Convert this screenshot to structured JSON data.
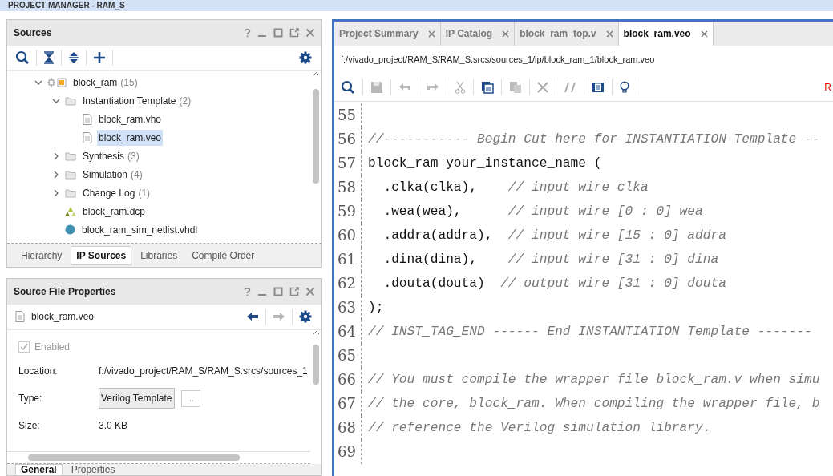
{
  "header": {
    "title": "PROJECT MANAGER - RAM_S"
  },
  "sources": {
    "title": "Sources",
    "tree": [
      {
        "label": "block_ram",
        "count": "(15)",
        "kind": "ip",
        "expanded": true,
        "selected": false,
        "children": [
          {
            "label": "Instantiation Template",
            "count": "(2)",
            "kind": "folder",
            "expanded": true,
            "selected": false,
            "children": [
              {
                "label": "block_ram.vho",
                "kind": "file",
                "selected": false
              },
              {
                "label": "block_ram.veo",
                "kind": "file",
                "selected": true
              }
            ]
          },
          {
            "label": "Synthesis",
            "count": "(3)",
            "kind": "folder",
            "expanded": false,
            "selected": false
          },
          {
            "label": "Simulation",
            "count": "(4)",
            "kind": "folder",
            "expanded": false,
            "selected": false
          },
          {
            "label": "Change Log",
            "count": "(1)",
            "kind": "folder",
            "expanded": false,
            "selected": false
          },
          {
            "label": "block_ram.dcp",
            "kind": "dcp",
            "selected": false
          },
          {
            "label": "block_ram_sim_netlist.vhdl",
            "kind": "netlist",
            "selected": false
          }
        ]
      }
    ],
    "tabs": [
      {
        "label": "Hierarchy",
        "selected": false
      },
      {
        "label": "IP Sources",
        "selected": true
      },
      {
        "label": "Libraries",
        "selected": false
      },
      {
        "label": "Compile Order",
        "selected": false
      }
    ]
  },
  "properties": {
    "title": "Source File Properties",
    "file": "block_ram.veo",
    "enabled": {
      "label": "Enabled",
      "checked": true,
      "disabled": true
    },
    "fields": [
      {
        "label": "Location:",
        "value": "f:/vivado_project/RAM_S/RAM_S.srcs/sources_1",
        "kind": "text"
      },
      {
        "label": "Type:",
        "value": "Verilog Template",
        "kind": "button",
        "more": "..."
      },
      {
        "label": "Size:",
        "value": "3.0 KB",
        "kind": "text"
      }
    ],
    "tabs": [
      {
        "label": "General",
        "selected": true
      },
      {
        "label": "Properties",
        "selected": false
      }
    ]
  },
  "editor": {
    "tabs": [
      {
        "label": "Project Summary",
        "selected": false
      },
      {
        "label": "IP Catalog",
        "selected": false
      },
      {
        "label": "block_ram_top.v",
        "selected": false
      },
      {
        "label": "block_ram.veo",
        "selected": true
      }
    ],
    "path": "f:/vivado_project/RAM_S/RAM_S.srcs/sources_1/ip/block_ram_1/block_ram.veo",
    "toolbar_edge_text": "R",
    "lines": [
      {
        "number": "55"
      },
      {
        "number": "56",
        "comment": "//----------- Begin Cut here for INSTANTIATION Template --"
      },
      {
        "number": "57",
        "code": "block_ram your_instance_name ("
      },
      {
        "number": "58",
        "code": "  .clka(clka),    ",
        "comment": "// input wire clka"
      },
      {
        "number": "59",
        "code": "  .wea(wea),      ",
        "comment": "// input wire [0 : 0] wea"
      },
      {
        "number": "60",
        "code": "  .addra(addra),  ",
        "comment": "// input wire [15 : 0] addra"
      },
      {
        "number": "61",
        "code": "  .dina(dina),    ",
        "comment": "// input wire [31 : 0] dina"
      },
      {
        "number": "62",
        "code": "  .douta(douta)  ",
        "comment": "// output wire [31 : 0] douta"
      },
      {
        "number": "63",
        "code": ");"
      },
      {
        "number": "64",
        "comment": "// INST_TAG_END ------ End INSTANTIATION Template -------"
      },
      {
        "number": "65"
      },
      {
        "number": "66",
        "comment": "// You must compile the wrapper file block_ram.v when simu"
      },
      {
        "number": "67",
        "comment": "// the core, block_ram. When compiling the wrapper file, b"
      },
      {
        "number": "68",
        "comment": "// reference the Verilog simulation library."
      },
      {
        "number": "69"
      }
    ]
  }
}
